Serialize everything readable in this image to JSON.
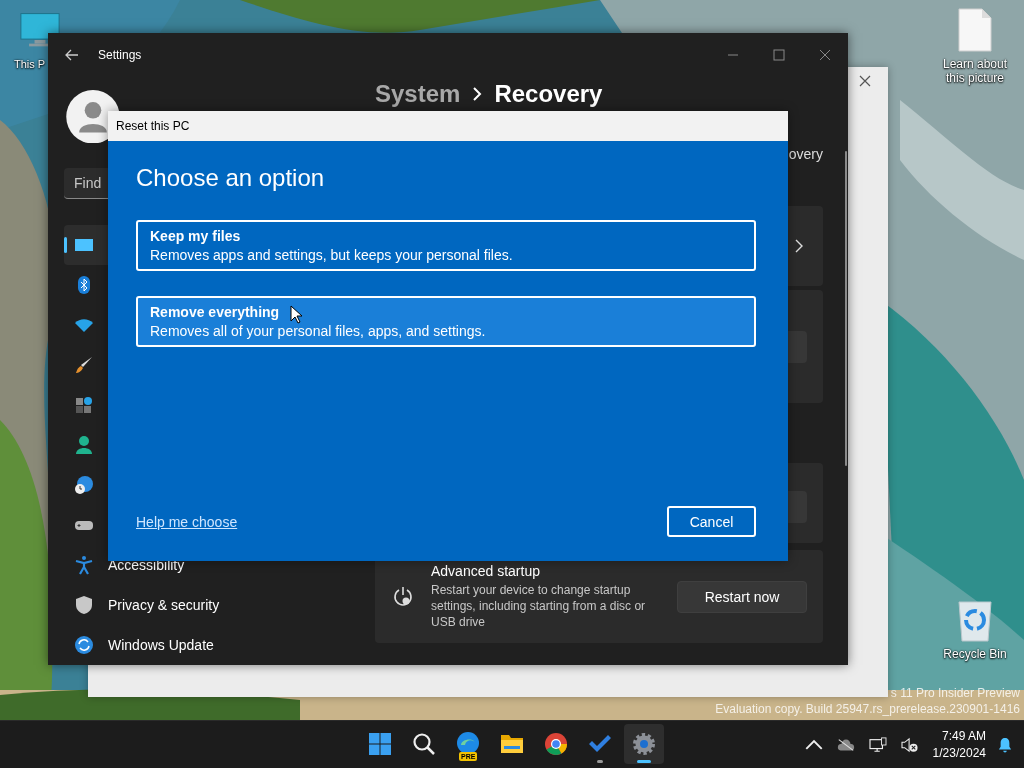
{
  "desktop": {
    "icons": [
      {
        "kind": "computer",
        "label": "This P"
      },
      {
        "kind": "document",
        "label": "Learn about this picture"
      },
      {
        "kind": "recycle",
        "label": "Recycle Bin"
      }
    ],
    "watermark": [
      "s 11 Pro Insider Preview",
      "Evaluation copy. Build 25947.rs_prerelease.230901-1416"
    ]
  },
  "settings_window": {
    "title": "Settings",
    "search": {
      "placeholder": "Find"
    },
    "breadcrumb": [
      "System",
      "Recovery"
    ],
    "intro_fragment": "overy",
    "nav": [
      {
        "selected": true
      },
      {
        "selected": false
      },
      {
        "selected": false
      },
      {
        "selected": false
      },
      {
        "selected": false
      },
      {
        "selected": false
      },
      {
        "selected": false
      },
      {
        "selected": false
      },
      {
        "label": "Accessibility",
        "selected": false
      },
      {
        "label": "Privacy & security",
        "selected": false
      },
      {
        "label": "Windows Update",
        "selected": false
      }
    ],
    "advanced_startup": {
      "title": "Advanced startup",
      "description": "Restart your device to change startup settings, including starting from a disc or USB drive",
      "button": "Restart now"
    }
  },
  "dialog": {
    "title": "Reset this PC",
    "heading": "Choose an option",
    "options": [
      {
        "title": "Keep my files",
        "description": "Removes apps and settings, but keeps your personal files.",
        "selected": false
      },
      {
        "title": "Remove everything",
        "description": "Removes all of your personal files, apps, and settings.",
        "selected": true
      }
    ],
    "help_link": "Help me choose",
    "cancel": "Cancel"
  },
  "taskbar": {
    "apps": [
      {
        "kind": "start",
        "running": false,
        "active": false
      },
      {
        "kind": "search",
        "running": false,
        "active": false
      },
      {
        "kind": "edge",
        "badge": "PRE",
        "running": false,
        "active": false
      },
      {
        "kind": "explorer",
        "running": false,
        "active": false
      },
      {
        "kind": "chrome",
        "running": false,
        "active": false
      },
      {
        "kind": "todo",
        "running": true,
        "active": false
      },
      {
        "kind": "settings",
        "running": true,
        "active": true
      }
    ],
    "time": "7:49 AM",
    "date": "1/23/2024"
  }
}
